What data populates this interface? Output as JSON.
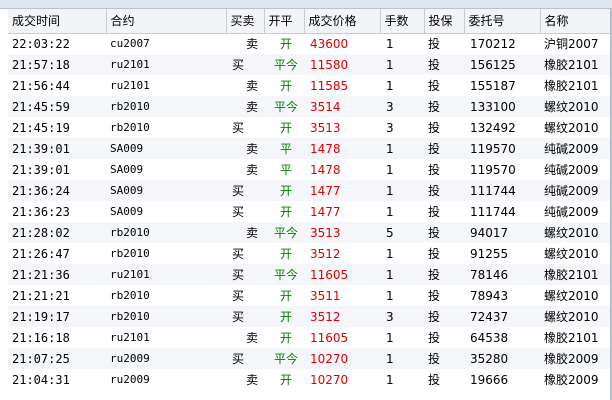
{
  "table": {
    "headers": [
      "成交时间",
      "合约",
      "买卖",
      "开平",
      "成交价格",
      "手数",
      "投保",
      "委托号",
      "名称"
    ],
    "rows": [
      {
        "time": "22:03:22",
        "symbol": "cu2007",
        "side": "卖",
        "oc": "开",
        "price": "43600",
        "qty": "1",
        "hedge": "投",
        "order": "170212",
        "name": "沪铜2007"
      },
      {
        "time": "21:57:18",
        "symbol": "ru2101",
        "side": "买",
        "oc": "平今",
        "price": "11580",
        "qty": "1",
        "hedge": "投",
        "order": "156125",
        "name": "橡胶2101"
      },
      {
        "time": "21:56:44",
        "symbol": "ru2101",
        "side": "卖",
        "oc": "开",
        "price": "11585",
        "qty": "1",
        "hedge": "投",
        "order": "155187",
        "name": "橡胶2101"
      },
      {
        "time": "21:45:59",
        "symbol": "rb2010",
        "side": "卖",
        "oc": "平今",
        "price": "3514",
        "qty": "3",
        "hedge": "投",
        "order": "133100",
        "name": "螺纹2010"
      },
      {
        "time": "21:45:19",
        "symbol": "rb2010",
        "side": "买",
        "oc": "开",
        "price": "3513",
        "qty": "3",
        "hedge": "投",
        "order": "132492",
        "name": "螺纹2010"
      },
      {
        "time": "21:39:01",
        "symbol": "SA009",
        "side": "卖",
        "oc": "平",
        "price": "1478",
        "qty": "1",
        "hedge": "投",
        "order": "119570",
        "name": "纯碱2009"
      },
      {
        "time": "21:39:01",
        "symbol": "SA009",
        "side": "卖",
        "oc": "平",
        "price": "1478",
        "qty": "1",
        "hedge": "投",
        "order": "119570",
        "name": "纯碱2009"
      },
      {
        "time": "21:36:24",
        "symbol": "SA009",
        "side": "买",
        "oc": "开",
        "price": "1477",
        "qty": "1",
        "hedge": "投",
        "order": "111744",
        "name": "纯碱2009"
      },
      {
        "time": "21:36:23",
        "symbol": "SA009",
        "side": "买",
        "oc": "开",
        "price": "1477",
        "qty": "1",
        "hedge": "投",
        "order": "111744",
        "name": "纯碱2009"
      },
      {
        "time": "21:28:02",
        "symbol": "rb2010",
        "side": "卖",
        "oc": "平今",
        "price": "3513",
        "qty": "5",
        "hedge": "投",
        "order": "94017",
        "name": "螺纹2010"
      },
      {
        "time": "21:26:47",
        "symbol": "rb2010",
        "side": "买",
        "oc": "开",
        "price": "3512",
        "qty": "1",
        "hedge": "投",
        "order": "91255",
        "name": "螺纹2010"
      },
      {
        "time": "21:21:36",
        "symbol": "ru2101",
        "side": "买",
        "oc": "平今",
        "price": "11605",
        "qty": "1",
        "hedge": "投",
        "order": "78146",
        "name": "橡胶2101"
      },
      {
        "time": "21:21:21",
        "symbol": "rb2010",
        "side": "买",
        "oc": "开",
        "price": "3511",
        "qty": "1",
        "hedge": "投",
        "order": "78943",
        "name": "螺纹2010"
      },
      {
        "time": "21:19:17",
        "symbol": "rb2010",
        "side": "买",
        "oc": "开",
        "price": "3512",
        "qty": "3",
        "hedge": "投",
        "order": "72437",
        "name": "螺纹2010"
      },
      {
        "time": "21:16:18",
        "symbol": "ru2101",
        "side": "卖",
        "oc": "开",
        "price": "11605",
        "qty": "1",
        "hedge": "投",
        "order": "64538",
        "name": "橡胶2101"
      },
      {
        "time": "21:07:25",
        "symbol": "ru2009",
        "side": "买",
        "oc": "平今",
        "price": "10270",
        "qty": "1",
        "hedge": "投",
        "order": "35280",
        "name": "橡胶2009"
      },
      {
        "time": "21:04:31",
        "symbol": "ru2009",
        "side": "卖",
        "oc": "开",
        "price": "10270",
        "qty": "1",
        "hedge": "投",
        "order": "19666",
        "name": "橡胶2009"
      }
    ]
  },
  "colors": {
    "price": "#e00000",
    "open_close": "#008000"
  }
}
